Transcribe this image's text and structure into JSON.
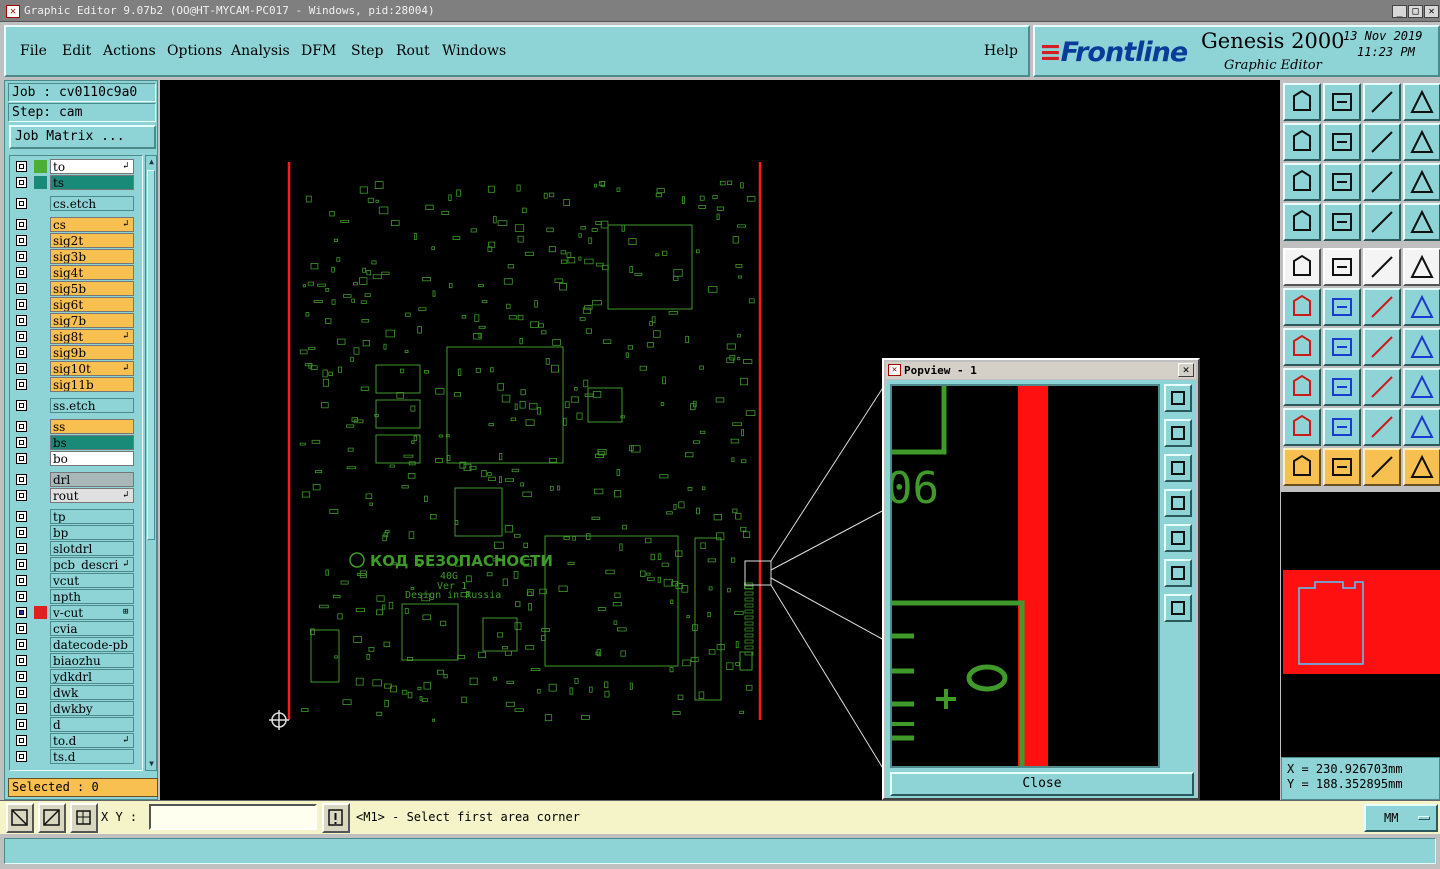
{
  "window": {
    "title": "Graphic Editor 9.07b2 (OO@HT-MYCAM-PC017 - Windows, pid:28004)"
  },
  "menu": {
    "items": [
      "File",
      "Edit",
      "Actions",
      "Options",
      "Analysis",
      "DFM",
      "Step",
      "Rout",
      "Windows"
    ],
    "help": "Help"
  },
  "brand": {
    "logo": "Frontline",
    "product": "Genesis 2000",
    "subtitle": "Graphic Editor",
    "date": "13 Nov 2019",
    "time": "11:23 PM"
  },
  "job": {
    "job_label": "Job  : cv0110c9a0",
    "step_label": "Step: cam",
    "matrix_button": "Job Matrix ..."
  },
  "layers": [
    {
      "name": "to",
      "sw": "#4caf33",
      "bg": "#ffffff",
      "mark": "↲"
    },
    {
      "name": "ts",
      "sw": "#1a8a78",
      "bg": "#1a8a78",
      "mark": ""
    },
    {
      "name": "cs.etch",
      "sw": "",
      "bg": "#8ed4d6",
      "mark": ""
    },
    {
      "name": "cs",
      "sw": "",
      "bg": "#f7c050",
      "mark": "↲"
    },
    {
      "name": "sig2t",
      "sw": "",
      "bg": "#f7c050",
      "mark": ""
    },
    {
      "name": "sig3b",
      "sw": "",
      "bg": "#f7c050",
      "mark": ""
    },
    {
      "name": "sig4t",
      "sw": "",
      "bg": "#f7c050",
      "mark": ""
    },
    {
      "name": "sig5b",
      "sw": "",
      "bg": "#f7c050",
      "mark": ""
    },
    {
      "name": "sig6t",
      "sw": "",
      "bg": "#f7c050",
      "mark": ""
    },
    {
      "name": "sig7b",
      "sw": "",
      "bg": "#f7c050",
      "mark": ""
    },
    {
      "name": "sig8t",
      "sw": "",
      "bg": "#f7c050",
      "mark": "↲"
    },
    {
      "name": "sig9b",
      "sw": "",
      "bg": "#f7c050",
      "mark": ""
    },
    {
      "name": "sig10t",
      "sw": "",
      "bg": "#f7c050",
      "mark": "↲"
    },
    {
      "name": "sig11b",
      "sw": "",
      "bg": "#f7c050",
      "mark": ""
    },
    {
      "name": "ss.etch",
      "sw": "",
      "bg": "#8ed4d6",
      "mark": ""
    },
    {
      "name": "ss",
      "sw": "",
      "bg": "#f7c050",
      "mark": ""
    },
    {
      "name": "bs",
      "sw": "",
      "bg": "#1a8a78",
      "mark": ""
    },
    {
      "name": "bo",
      "sw": "",
      "bg": "#ffffff",
      "mark": ""
    },
    {
      "name": "drl",
      "sw": "",
      "bg": "#a8b8b8",
      "mark": ""
    },
    {
      "name": "rout",
      "sw": "",
      "bg": "#e0e0e0",
      "mark": "↲"
    },
    {
      "name": "tp",
      "sw": "",
      "bg": "#8ed4d6",
      "mark": ""
    },
    {
      "name": "bp",
      "sw": "",
      "bg": "#8ed4d6",
      "mark": ""
    },
    {
      "name": "slotdrl",
      "sw": "",
      "bg": "#8ed4d6",
      "mark": ""
    },
    {
      "name": "pcb_descri",
      "sw": "",
      "bg": "#8ed4d6",
      "mark": "↲"
    },
    {
      "name": "vcut",
      "sw": "",
      "bg": "#8ed4d6",
      "mark": ""
    },
    {
      "name": "npth",
      "sw": "",
      "bg": "#8ed4d6",
      "mark": ""
    },
    {
      "name": "v-cut",
      "sw": "#e02020",
      "bg": "#8ed4d6",
      "mark": "⊞"
    },
    {
      "name": "cvia",
      "sw": "",
      "bg": "#8ed4d6",
      "mark": ""
    },
    {
      "name": "datecode-pb",
      "sw": "",
      "bg": "#8ed4d6",
      "mark": ""
    },
    {
      "name": "biaozhu",
      "sw": "",
      "bg": "#8ed4d6",
      "mark": ""
    },
    {
      "name": "ydkdrl",
      "sw": "",
      "bg": "#8ed4d6",
      "mark": ""
    },
    {
      "name": "dwk",
      "sw": "",
      "bg": "#8ed4d6",
      "mark": ""
    },
    {
      "name": "dwkby",
      "sw": "",
      "bg": "#8ed4d6",
      "mark": ""
    },
    {
      "name": "d",
      "sw": "",
      "bg": "#8ed4d6",
      "mark": ""
    },
    {
      "name": "to.d",
      "sw": "",
      "bg": "#8ed4d6",
      "mark": "↲"
    },
    {
      "name": "ts.d",
      "sw": "",
      "bg": "#8ed4d6",
      "mark": ""
    }
  ],
  "selected": "Selected : 0",
  "board": {
    "label": "КОД БЕЗОПАСНОСТИ",
    "model": "40G",
    "version": "Ver 1",
    "origin": "Design in Russia"
  },
  "popview": {
    "title": "Popview - 1",
    "zoom_label": "06",
    "close": "Close"
  },
  "coords": {
    "x": "X = 230.926703mm",
    "y": "Y = 188.352895mm"
  },
  "status": {
    "xy_label": "X Y :",
    "xy_value": "",
    "prompt": "<M1> - Select first area corner",
    "units": "MM"
  },
  "colors": {
    "panel": "#8ed4d6",
    "trace": "#3f9a2a",
    "outline": "#e02020",
    "highlight": "#f7c050"
  }
}
